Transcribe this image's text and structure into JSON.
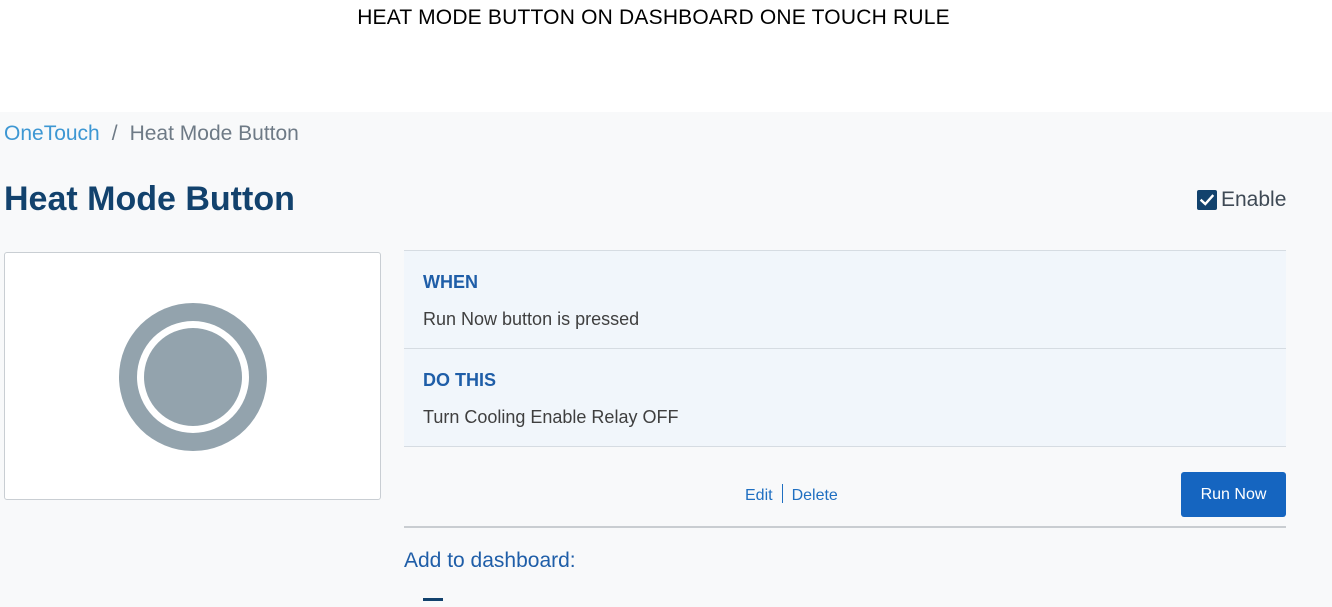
{
  "doc": {
    "title": "HEAT MODE BUTTON ON DASHBOARD ONE TOUCH RULE"
  },
  "breadcrumb": {
    "root": "OneTouch",
    "separator": "/",
    "current": "Heat Mode Button"
  },
  "page": {
    "title": "Heat Mode Button"
  },
  "enable": {
    "label": "Enable",
    "checked": true
  },
  "icon": {
    "name": "circle-button-icon",
    "color": "#93a3ad"
  },
  "rule": {
    "when_heading": "WHEN",
    "when_text": "Run Now button is pressed",
    "do_heading": "DO THIS",
    "do_text": "Turn Cooling Enable Relay OFF"
  },
  "actions": {
    "edit_label": "Edit",
    "delete_label": "Delete",
    "run_now_label": "Run Now"
  },
  "dashboard": {
    "label": "Add to dashboard:"
  },
  "colors": {
    "accent": "#1565c0",
    "title": "#12426d",
    "link": "#3d97d3"
  }
}
